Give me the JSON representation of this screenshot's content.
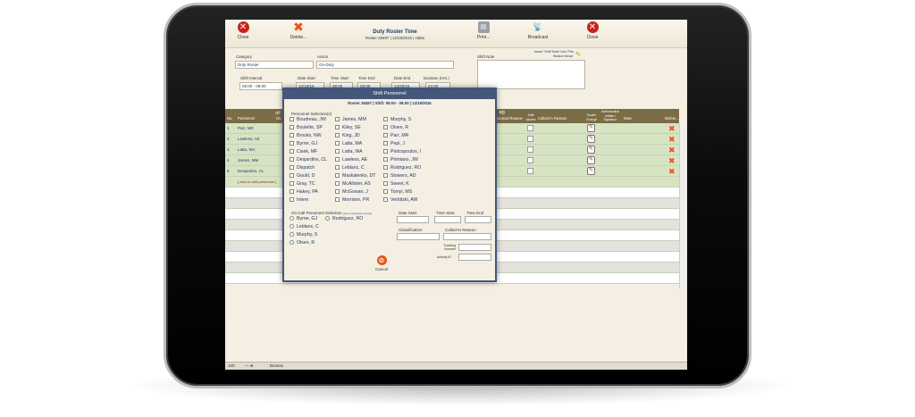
{
  "toolbar": {
    "close_left": "Close",
    "delete": "Delete...",
    "title": "Duty Roster Time",
    "subtitle": "Roster 28497 | 12/19/2016 | vlatta",
    "print": "Print...",
    "broadcast": "Broadcast",
    "close_right": "Close"
  },
  "form": {
    "category_label": "Category",
    "category_value": "Duty Roster",
    "action_label": "Action",
    "action_value": "On-Duty",
    "shift_note_label": "Shift Note",
    "insert_note_link": "Insert 'Shift Note' into 'Fire Station News'",
    "shift_interval_label": "Shift Interval",
    "shift_interval_value": "08:00 - 08:00",
    "date_start_label": "Date Start",
    "date_start_value": "12/19/16",
    "time_start_label": "Time Start",
    "time_start_value": "08:00",
    "time_end_label": "Time End",
    "time_end_value": "08:00",
    "date_end_label": "Date End",
    "date_end_value": "12/20/16",
    "duration_label": "Duration (Hrs.)",
    "duration_value": "24.00"
  },
  "grid": {
    "header_q": "IQ)",
    "col_no": "No.",
    "col_personnel": "Personnel",
    "col_off": "Off",
    "col_ov": "Ov",
    "col_excused": "xcused Reason",
    "col_shift_absent": "Shift Absent",
    "col_calledin": "Called-In Reason",
    "col_roster_change": "Roster Change",
    "col_auth": "Authorization Initials / Signature",
    "col_note": "Note",
    "col_delete": "Delete...",
    "rows": [
      {
        "no": "1",
        "name": "Parr, MR"
      },
      {
        "no": "2",
        "name": "Lawless, AE"
      },
      {
        "no": "3",
        "name": "Latta, WA"
      },
      {
        "no": "4",
        "name": "James, MM"
      },
      {
        "no": "5",
        "name": "Desjardins, CL"
      }
    ],
    "add_personnel": "[ click to add personnel ]",
    "change_icon": "✎",
    "delete_icon": "✖"
  },
  "status": {
    "zoom": "100",
    "mode": "Browse"
  },
  "modal": {
    "title": "Shift Personnel",
    "subtitle": "Roster 28497  |  Shift: 08:00 - 08:00  |  12/19/2016",
    "selection_label": "Personnel Selection(s)",
    "col1": [
      "Boudreau, JW",
      "Boulette, SP",
      "Brooks, NW",
      "Byrne, GJ",
      "Cisek, MF",
      "Desjardins, CL",
      "Dispatch",
      "Gould, D",
      "Gray, TC",
      "Hakey, PA",
      "Intern"
    ],
    "col2": [
      "James, MM",
      "Kiley, SE",
      "King, JD",
      "Latta, MA",
      "Latta, WA",
      "Lawless, AE",
      "Leblanc, C",
      "Maskalenko, DT",
      "McAllister, AS",
      "McGowan, J",
      "Morrison, PR"
    ],
    "col3": [
      "Murphy, S",
      "Olsen, R",
      "Parr, MR",
      "Pepi, J",
      "Pintcopoulos, I",
      "Primiano, JW",
      "Rodriguez, RO",
      "Stowers, AD",
      "Sweet, K",
      "Tomyl, MS",
      "Verbitzki, AW"
    ],
    "oncall_label": "On-Call Personnel Selection",
    "oncall_hint": "(set in employee record)",
    "oncall": [
      "Byrne, GJ",
      "Leblanc, C",
      "Murphy, S",
      "Olsen, R"
    ],
    "oncall_extra": "Rodriguez, RO",
    "date_start_label": "Date Start",
    "time_start_label": "Time Start",
    "time_end_label": "Time End",
    "classification_label": "Classification",
    "calledin_label": "Called-In Reason",
    "tracking_label": "Tracking Number",
    "activity_label": "Activity ID",
    "cancel_label": "Cancel"
  }
}
